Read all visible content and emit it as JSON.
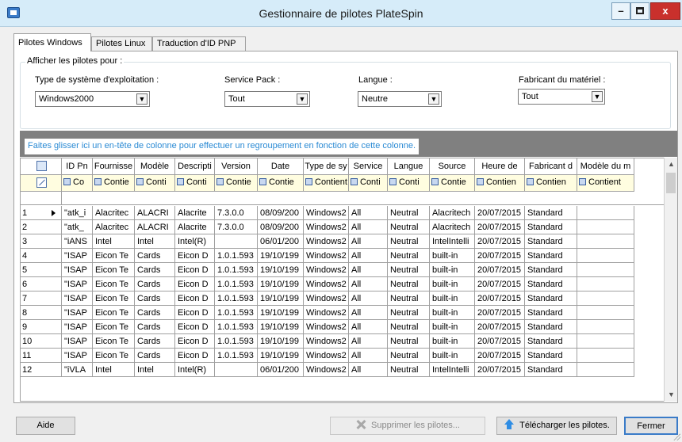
{
  "window": {
    "title": "Gestionnaire de pilotes PlateSpin",
    "controls": {
      "minimize": "–",
      "close": "x"
    }
  },
  "tabs": [
    {
      "label": "Pilotes Windows",
      "active": true
    },
    {
      "label": "Pilotes Linux",
      "active": false
    },
    {
      "label": "Traduction d'ID PNP",
      "active": false
    }
  ],
  "filters": {
    "group_label": "Afficher les pilotes pour :",
    "os": {
      "label": "Type de système d'exploitation :",
      "value": "Windows2000"
    },
    "service_pack": {
      "label": "Service Pack :",
      "value": "Tout"
    },
    "language": {
      "label": "Langue :",
      "value": "Neutre"
    },
    "manufacturer": {
      "label": "Fabricant du matériel :",
      "value": "Tout"
    }
  },
  "grid": {
    "group_hint": "Faites glisser ici un en-tête de colonne pour effectuer un regroupement en fonction de cette colonne.",
    "columns": [
      "ID Pn",
      "Fournisse",
      "Modèle",
      "Descripti",
      "Version",
      "Date",
      "Type de sy",
      "Service",
      "Langue",
      "Source",
      "Heure de",
      "Fabricant d",
      "Modèle du m"
    ],
    "filter_row": [
      "Co",
      "Contie",
      "Conti",
      "Conti",
      "Contie",
      "Contie",
      "Contient",
      "Conti",
      "Conti",
      "Contie",
      "Contien",
      "Contien",
      "Contient"
    ],
    "rows": [
      {
        "n": "1",
        "cells": [
          "\"atk_i",
          "Alacritec",
          "ALACRI",
          "Alacrite",
          "7.3.0.0",
          "08/09/200",
          "Windows2",
          "All",
          "Neutral",
          "Alacritech",
          "20/07/2015",
          "Standard",
          ""
        ]
      },
      {
        "n": "2",
        "cells": [
          "\"atk_",
          "Alacritec",
          "ALACRI",
          "Alacrite",
          "7.3.0.0",
          "08/09/200",
          "Windows2",
          "All",
          "Neutral",
          "Alacritech",
          "20/07/2015",
          "Standard",
          ""
        ]
      },
      {
        "n": "3",
        "cells": [
          "\"iANS",
          "Intel",
          "Intel",
          "Intel(R)",
          "",
          "06/01/200",
          "Windows2",
          "All",
          "Neutral",
          "IntelIntelli",
          "20/07/2015",
          "Standard",
          ""
        ]
      },
      {
        "n": "4",
        "cells": [
          "\"ISAP",
          "Eicon Te",
          "Cards",
          "Eicon D",
          "1.0.1.593",
          "19/10/199",
          "Windows2",
          "All",
          "Neutral",
          "built-in",
          "20/07/2015",
          "Standard",
          ""
        ]
      },
      {
        "n": "5",
        "cells": [
          "\"ISAP",
          "Eicon Te",
          "Cards",
          "Eicon D",
          "1.0.1.593",
          "19/10/199",
          "Windows2",
          "All",
          "Neutral",
          "built-in",
          "20/07/2015",
          "Standard",
          ""
        ]
      },
      {
        "n": "6",
        "cells": [
          "\"ISAP",
          "Eicon Te",
          "Cards",
          "Eicon D",
          "1.0.1.593",
          "19/10/199",
          "Windows2",
          "All",
          "Neutral",
          "built-in",
          "20/07/2015",
          "Standard",
          ""
        ]
      },
      {
        "n": "7",
        "cells": [
          "\"ISAP",
          "Eicon Te",
          "Cards",
          "Eicon D",
          "1.0.1.593",
          "19/10/199",
          "Windows2",
          "All",
          "Neutral",
          "built-in",
          "20/07/2015",
          "Standard",
          ""
        ]
      },
      {
        "n": "8",
        "cells": [
          "\"ISAP",
          "Eicon Te",
          "Cards",
          "Eicon D",
          "1.0.1.593",
          "19/10/199",
          "Windows2",
          "All",
          "Neutral",
          "built-in",
          "20/07/2015",
          "Standard",
          ""
        ]
      },
      {
        "n": "9",
        "cells": [
          "\"ISAP",
          "Eicon Te",
          "Cards",
          "Eicon D",
          "1.0.1.593",
          "19/10/199",
          "Windows2",
          "All",
          "Neutral",
          "built-in",
          "20/07/2015",
          "Standard",
          ""
        ]
      },
      {
        "n": "10",
        "cells": [
          "\"ISAP",
          "Eicon Te",
          "Cards",
          "Eicon D",
          "1.0.1.593",
          "19/10/199",
          "Windows2",
          "All",
          "Neutral",
          "built-in",
          "20/07/2015",
          "Standard",
          ""
        ]
      },
      {
        "n": "11",
        "cells": [
          "\"ISAP",
          "Eicon Te",
          "Cards",
          "Eicon D",
          "1.0.1.593",
          "19/10/199",
          "Windows2",
          "All",
          "Neutral",
          "built-in",
          "20/07/2015",
          "Standard",
          ""
        ]
      },
      {
        "n": "12",
        "cells": [
          "\"iVLA",
          "Intel",
          "Intel",
          "Intel(R)",
          "",
          "06/01/200",
          "Windows2",
          "All",
          "Neutral",
          "IntelIntelli",
          "20/07/2015",
          "Standard",
          ""
        ]
      }
    ]
  },
  "buttons": {
    "help": "Aide",
    "delete": "Supprimer les pilotes...",
    "upload": "Télécharger les pilotes.",
    "close": "Fermer"
  },
  "icons": [
    "app-icon",
    "delete-icon",
    "upload-arrow-icon",
    "row-pointer-icon",
    "column-chooser-icon",
    "clear-filter-icon"
  ]
}
